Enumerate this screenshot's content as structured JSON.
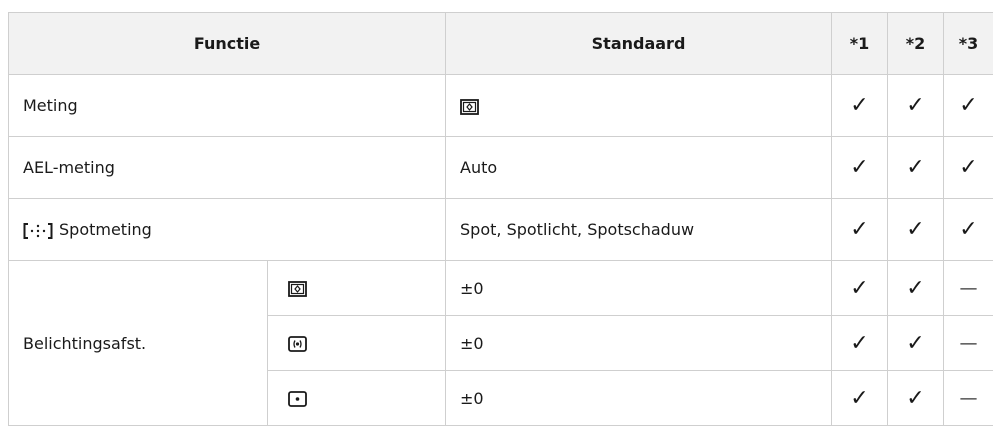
{
  "headers": {
    "functie": "Functie",
    "standaard": "Standaard",
    "c1": "*1",
    "c2": "*2",
    "c3": "*3"
  },
  "rows": [
    {
      "label": "Meting",
      "standaard_icon": "ese-metering-icon",
      "c1": "✓",
      "c2": "✓",
      "c3": "✓"
    },
    {
      "label": "AEL-meting",
      "standaard": "Auto",
      "c1": "✓",
      "c2": "✓",
      "c3": "✓"
    },
    {
      "label_icon": "spot-metering-bracket-icon",
      "label": "Spotmeting",
      "standaard": "Spot, Spotlicht, Spotschaduw",
      "c1": "✓",
      "c2": "✓",
      "c3": "✓"
    }
  ],
  "exposure": {
    "label": "Belichtingsafst.",
    "subrows": [
      {
        "icon": "ese-metering-icon",
        "standaard": "±0",
        "c1": "✓",
        "c2": "✓",
        "c3": "—"
      },
      {
        "icon": "center-weighted-metering-icon",
        "standaard": "±0",
        "c1": "✓",
        "c2": "✓",
        "c3": "—"
      },
      {
        "icon": "spot-metering-icon",
        "standaard": "±0",
        "c1": "✓",
        "c2": "✓",
        "c3": "—"
      }
    ]
  }
}
